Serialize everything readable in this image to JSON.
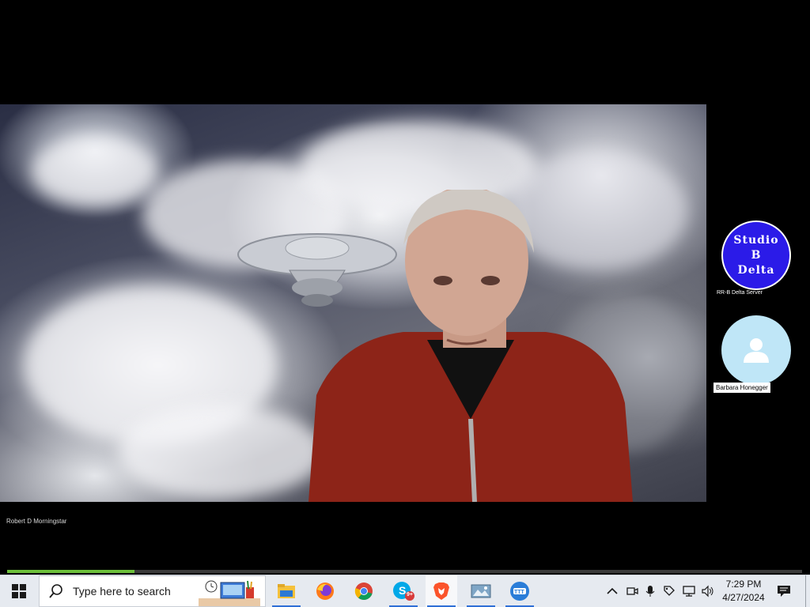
{
  "meeting": {
    "main_participant_name": "Robert D Morningstar",
    "participants": [
      {
        "name": "RR-B Delta Server",
        "avatar_text": [
          "Studio",
          "B",
          "Delta"
        ],
        "avatar_color": "#2b1be8"
      },
      {
        "name": "Barbara Honegger",
        "avatar_color": "#bfe6f7"
      }
    ],
    "progress_fraction": 0.16
  },
  "taskbar": {
    "search_placeholder": "Type here to search",
    "apps": [
      {
        "name": "file-explorer-icon"
      },
      {
        "name": "firefox-icon"
      },
      {
        "name": "chrome-icon"
      },
      {
        "name": "skype-icon",
        "badge": "9+"
      },
      {
        "name": "brave-icon"
      },
      {
        "name": "photos-icon"
      },
      {
        "name": "meeting-app-icon"
      }
    ],
    "clock": {
      "time": "7:29 PM",
      "date": "4/27/2024"
    }
  }
}
